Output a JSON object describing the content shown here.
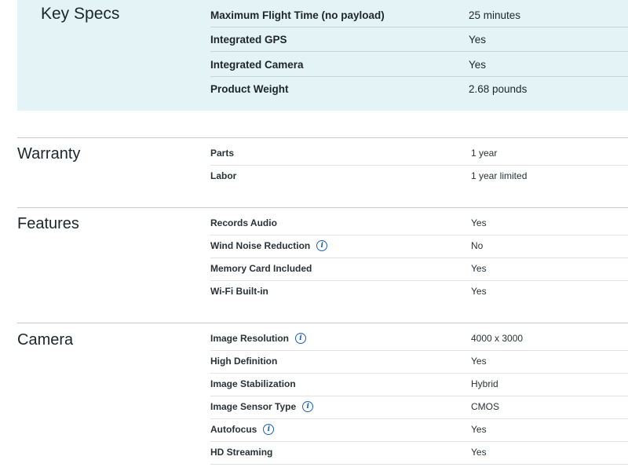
{
  "key_specs": {
    "title": "Key Specs",
    "rows": [
      {
        "label": "Maximum Flight Time (no payload)",
        "value": "25 minutes"
      },
      {
        "label": "Integrated GPS",
        "value": "Yes"
      },
      {
        "label": "Integrated Camera",
        "value": "Yes"
      },
      {
        "label": "Product Weight",
        "value": "2.68 pounds"
      }
    ]
  },
  "sections": [
    {
      "title": "Warranty",
      "rows": [
        {
          "label": "Parts",
          "value": "1 year",
          "info": false
        },
        {
          "label": "Labor",
          "value": "1 year limited",
          "info": false
        }
      ]
    },
    {
      "title": "Features",
      "rows": [
        {
          "label": "Records Audio",
          "value": "Yes",
          "info": false
        },
        {
          "label": "Wind Noise Reduction",
          "value": "No",
          "info": true
        },
        {
          "label": "Memory Card Included",
          "value": "Yes",
          "info": false
        },
        {
          "label": "Wi-Fi Built-in",
          "value": "Yes",
          "info": false
        }
      ]
    },
    {
      "title": "Camera",
      "rows": [
        {
          "label": "Image Resolution",
          "value": "4000 x 3000",
          "info": true
        },
        {
          "label": "High Definition",
          "value": "Yes",
          "info": false
        },
        {
          "label": "Image Stabilization",
          "value": "Hybrid",
          "info": false
        },
        {
          "label": "Image Sensor Type",
          "value": "CMOS",
          "info": true
        },
        {
          "label": "Autofocus",
          "value": "Yes",
          "info": true
        },
        {
          "label": "HD Streaming",
          "value": "Yes",
          "info": false
        }
      ]
    }
  ],
  "icons": {
    "info": "info-icon",
    "info_glyph": "i"
  },
  "colors": {
    "key_specs_bg": "#e4f3f5",
    "info_icon": "#1a5fb4"
  }
}
